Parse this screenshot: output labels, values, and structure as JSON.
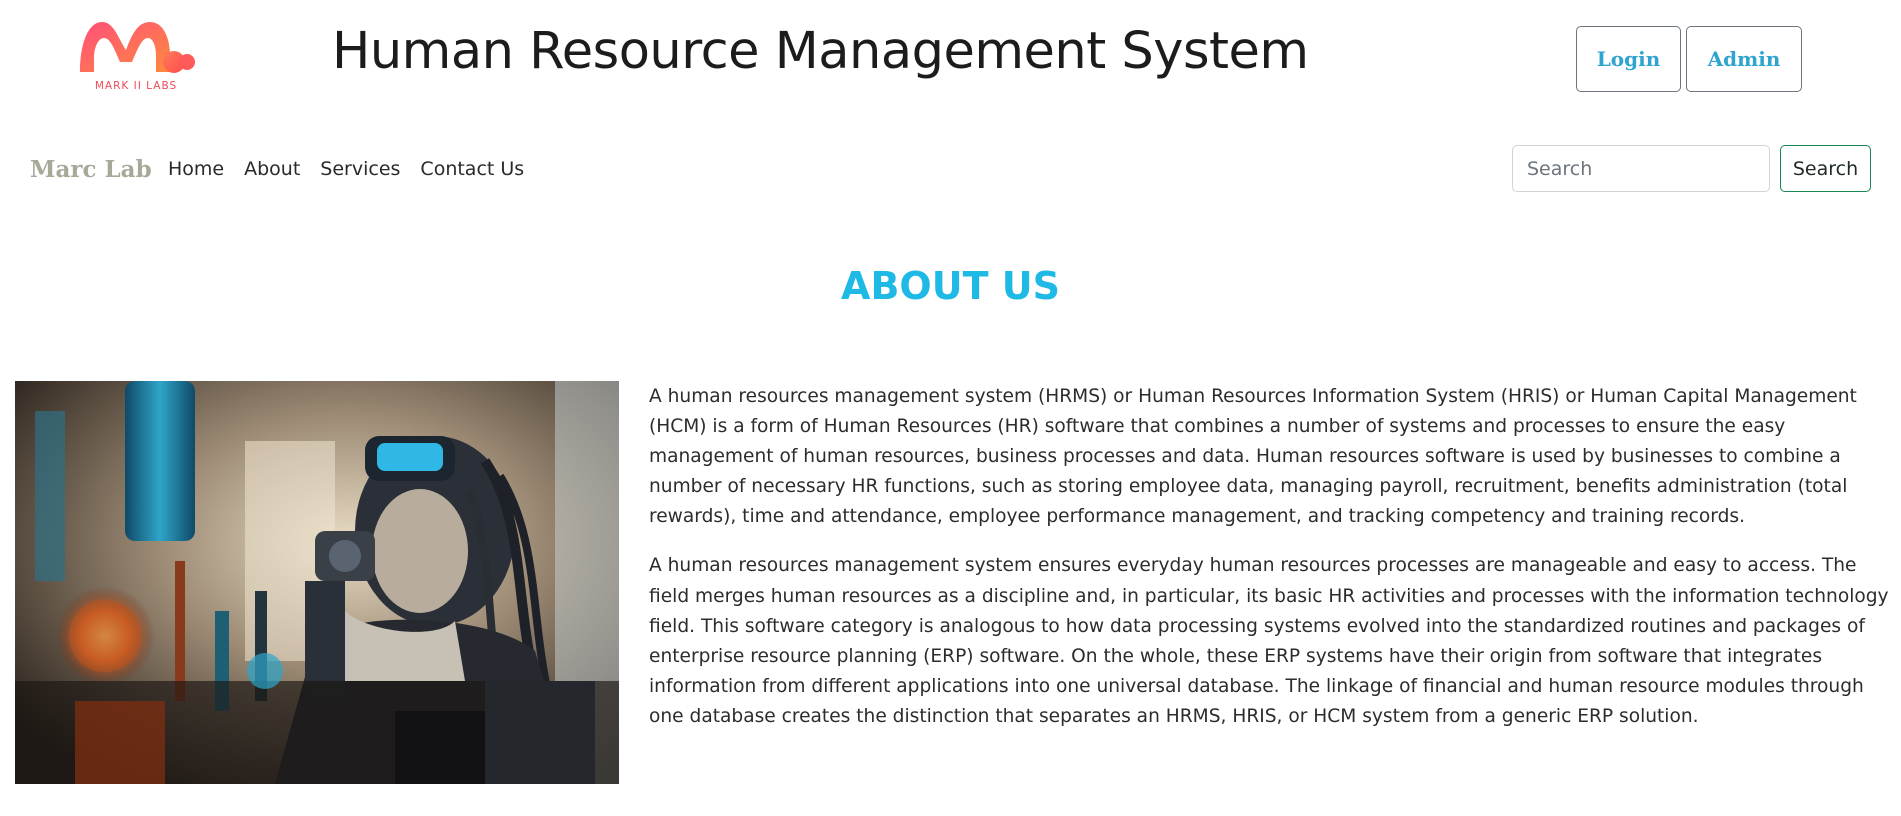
{
  "header": {
    "logo_text": "MARK II LABS",
    "title": "Human Resource Management System",
    "login_label": "Login",
    "admin_label": "Admin"
  },
  "navbar": {
    "brand": "Marc Lab",
    "links": [
      "Home",
      "About",
      "Services",
      "Contact Us"
    ],
    "search_placeholder": "Search",
    "search_button": "Search"
  },
  "about": {
    "heading": "ABOUT US",
    "image_icon": "scientist-illustration",
    "paragraphs": [
      "A human resources management system (HRMS) or Human Resources Information System (HRIS) or Human Capital Management (HCM) is a form of Human Resources (HR) software that combines a number of systems and processes to ensure the easy management of human resources, business processes and data. Human resources software is used by businesses to combine a number of necessary HR functions, such as storing employee data, managing payroll, recruitment, benefits administration (total rewards), time and attendance, employee performance management, and tracking competency and training records.",
      "A human resources management system ensures everyday human resources processes are manageable and easy to access. The field merges human resources as a discipline and, in particular, its basic HR activities and processes with the information technology field. This software category is analogous to how data processing systems evolved into the standardized routines and packages of enterprise resource planning (ERP) software. On the whole, these ERP systems have their origin from software that integrates information from different applications into one universal database. The linkage of financial and human resource modules through one database creates the distinction that separates an HRMS, HRIS, or HCM system from a generic ERP solution."
    ]
  },
  "colors": {
    "accent": "#1fb9e6",
    "button_text": "#2fa4cf",
    "brand": "#a8a898",
    "search_border": "#198754",
    "logo_gradient_start": "#ff4f6e",
    "logo_gradient_end": "#ff9a4a"
  }
}
